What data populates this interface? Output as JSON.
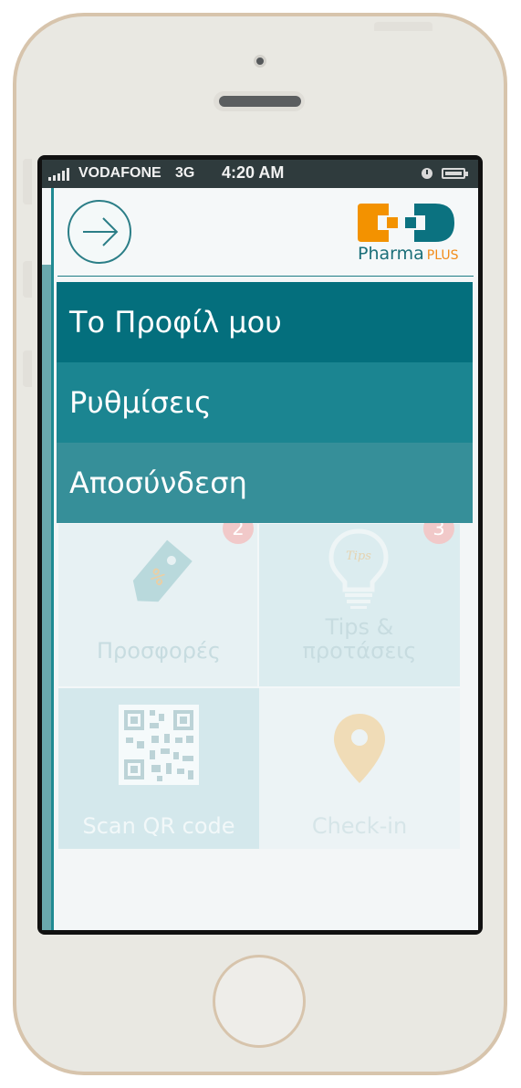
{
  "status_bar": {
    "carrier": "VODAFONE",
    "network": "3G",
    "time": "4:20 AM",
    "signal_bars": 5
  },
  "header": {
    "menu_toggle_icon": "arrow-right-icon",
    "logo": {
      "name": "Pharma",
      "suffix": "PLUS",
      "colors": {
        "orange": "#f39200",
        "teal": "#0b7280"
      }
    }
  },
  "menu": {
    "items": [
      {
        "label": "Το Προφίλ μου"
      },
      {
        "label": "Ρυθμίσεις"
      },
      {
        "label": "Αποσύνδεση"
      }
    ]
  },
  "tiles": [
    {
      "label": "Προσφορές",
      "icon": "discount-tag-icon",
      "badge": "2"
    },
    {
      "label_line1": "Tips &",
      "label_line2": "προτάσεις",
      "icon": "lightbulb-icon",
      "badge": "3"
    },
    {
      "label": "Scan QR code",
      "icon": "qr-code-icon"
    },
    {
      "label": "Check-in",
      "icon": "location-pin-icon"
    }
  ],
  "colors": {
    "menu_primary": "#046f7d",
    "menu_secondary": "#1b8591",
    "menu_tertiary": "#368f99",
    "phone_frame": "#d7c4ac"
  }
}
